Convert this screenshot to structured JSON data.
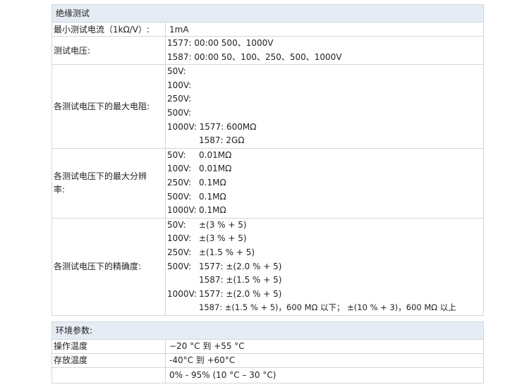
{
  "insulation": {
    "header": "绝缘测试",
    "min_current": {
      "label": "最小测试电流（1kΩ/V）:",
      "value": "1mA"
    },
    "test_voltage": {
      "label": "测试电压:",
      "lines": [
        "1577: 00:00 500、1000V",
        "1587: 00:00 50、100、250、500、1000V"
      ]
    },
    "max_resistance": {
      "label": "各测试电压下的最大电阻:",
      "lines": [
        "50V:",
        "100V:",
        "250V:",
        "500V:",
        "1000V: 1577: 600MΩ"
      ],
      "extra": "1587: 2GΩ"
    },
    "max_resolution": {
      "label_line1": "各测试电压下的最大分辨",
      "label_line2": "率:",
      "rows": [
        {
          "v": "50V:",
          "val": "0.01MΩ"
        },
        {
          "v": "100V:",
          "val": "0.01MΩ"
        },
        {
          "v": "250V:",
          "val": "0.1MΩ"
        },
        {
          "v": "500V:",
          "val": "0.1MΩ"
        },
        {
          "v": "1000V:",
          "val": "0.1MΩ"
        }
      ]
    },
    "accuracy": {
      "label": "各测试电压下的精确度:",
      "rows": [
        {
          "v": "50V:",
          "val": "±(3 % + 5)"
        },
        {
          "v": "100V:",
          "val": "±(3 % + 5)"
        },
        {
          "v": "250V:",
          "val": "±(1.5 % + 5)"
        },
        {
          "v": "500V:",
          "val": "1577: ±(2.0 % + 5)"
        },
        {
          "v": "",
          "val": "1587: ±(1.5 % + 5)"
        },
        {
          "v": "1000V:",
          "val": "1577: ±(2.0 % + 5)"
        },
        {
          "v": "",
          "val": "1587: ±(1.5 % + 5)，600 MΩ 以下； ±(10 % + 3)，600 MΩ 以上"
        }
      ]
    }
  },
  "environment": {
    "header": "环境参数:",
    "rows": [
      {
        "label": "操作温度",
        "value": "−20 °C 到 +55 °C"
      },
      {
        "label": "存放温度",
        "value": "-40°C 到 +60°C"
      },
      {
        "label": "",
        "value": "0% - 95% (10 °C – 30 °C)"
      }
    ]
  }
}
